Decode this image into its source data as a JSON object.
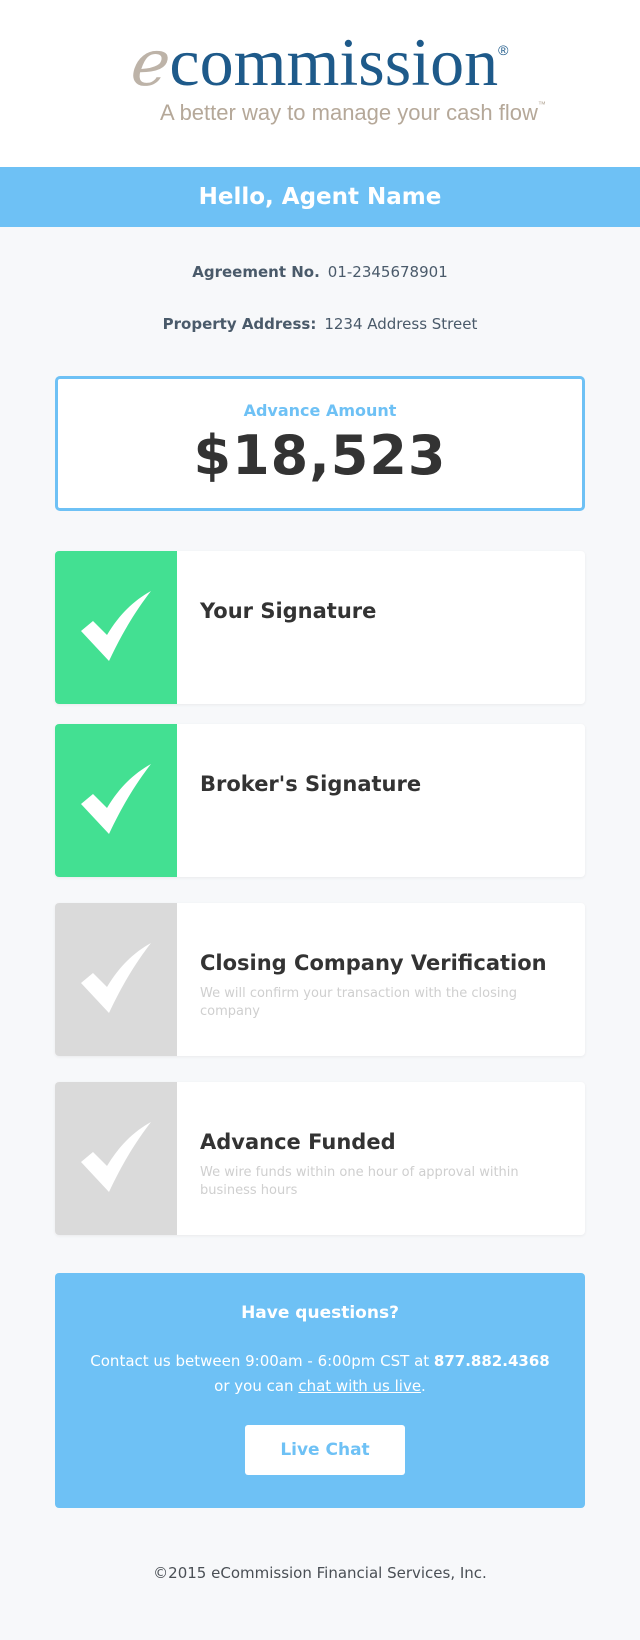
{
  "logo": {
    "e_letter": "e",
    "wordmark": "commission",
    "registered": "®",
    "tagline": "A better way to manage your cash flow",
    "trademark": "™"
  },
  "header": {
    "greeting": "Hello, Agent Name"
  },
  "agreement": {
    "number_label": "Agreement No.",
    "number_value": "01-2345678901",
    "address_label": "Property Address:",
    "address_value": "1234 Address Street"
  },
  "advance": {
    "label": "Advance Amount",
    "value": "$18,523"
  },
  "steps": [
    {
      "title": "Your Signature",
      "description": "",
      "status": "complete"
    },
    {
      "title": "Broker's Signature",
      "description": "",
      "status": "complete"
    },
    {
      "title": "Closing Company Verification",
      "description": "We will confirm your transaction with the closing company",
      "status": "pending"
    },
    {
      "title": "Advance Funded",
      "description": "We wire funds within one hour of approval within business hours",
      "status": "pending"
    }
  ],
  "help": {
    "title": "Have questions?",
    "text_before": "Contact us between 9:00am - 6:00pm CST at ",
    "phone": "877.882.4368",
    "text_middle": " or you can ",
    "chat_link": "chat with us live",
    "text_after": ".",
    "button_label": "Live Chat"
  },
  "footer": {
    "copyright": "©2015 eCommission Financial Services, Inc."
  },
  "colors": {
    "accent_blue": "#6ec1f5",
    "complete_green": "#43e092",
    "pending_gray": "#dadada",
    "logo_navy": "#1e5a8a",
    "logo_tan": "#b5a899"
  }
}
